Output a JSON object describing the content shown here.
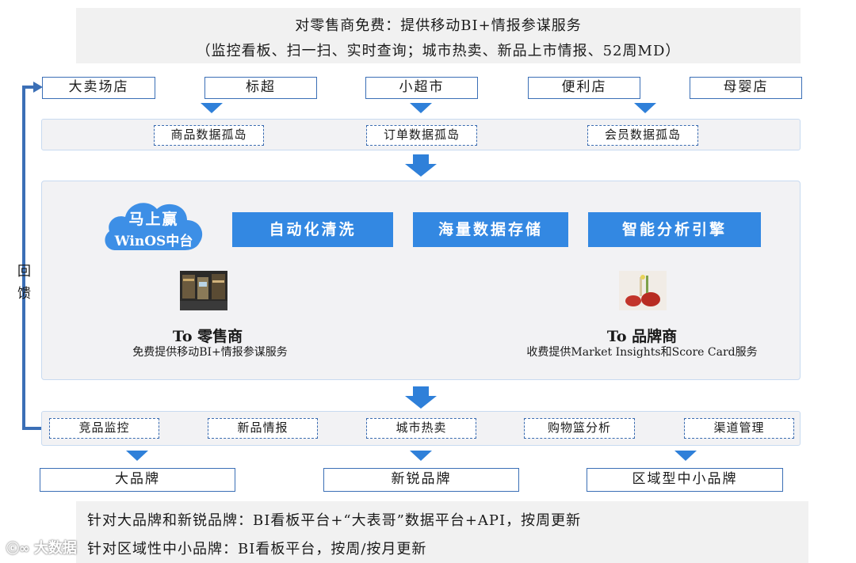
{
  "header": {
    "line1": "对零售商免费：提供移动BI+情报参谋服务",
    "line2": "（监控看板、扫一扫、实时查询；城市热卖、新品上市情报、52周MD）"
  },
  "stores": [
    "大卖场店",
    "标超",
    "小超市",
    "便利店",
    "母婴店"
  ],
  "silos": [
    "商品数据孤岛",
    "订单数据孤岛",
    "会员数据孤岛"
  ],
  "platform": {
    "cloud_line1": "马上赢",
    "cloud_line2": "WinOS中台",
    "functions": [
      "自动化清洗",
      "海量数据存储",
      "智能分析引擎"
    ],
    "retail": {
      "title": "To 零售商",
      "desc": "免费提供移动BI+情报参谋服务"
    },
    "brand": {
      "title": "To 品牌商",
      "desc": "收费提供Market Insights和Score Card服务"
    }
  },
  "feedback": {
    "char1": "回",
    "char2": "馈"
  },
  "services": [
    "竞品监控",
    "新品情报",
    "城市热卖",
    "购物篮分析",
    "渠道管理"
  ],
  "brands": [
    "大品牌",
    "新锐品牌",
    "区域型中小品牌"
  ],
  "footer": {
    "line1": "针对大品牌和新锐品牌：BI看板平台+“大表哥”数据平台+API，按周更新",
    "line2": "针对区域性中小品牌：BI看板平台，按周/按月更新"
  },
  "watermark": "大数据",
  "colors": {
    "accent": "#3388e2",
    "arrow": "#2f80d9",
    "border": "#3b6fb6",
    "panel": "#f2f2f4"
  }
}
